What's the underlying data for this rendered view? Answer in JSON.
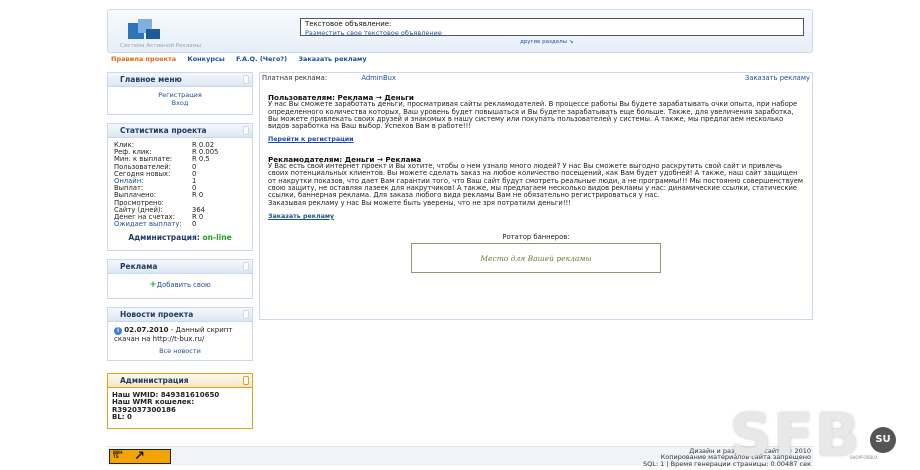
{
  "header": {
    "logo_text": "Система Активной Рекламы",
    "ad_title": "Текстовое объявление:",
    "ad_link": "Разместить свое текстовое объявление",
    "other_sections": "другие разделы ↘"
  },
  "nav": {
    "items": [
      "Правила проекта",
      "Конкурсы",
      "F.A.Q. (Чего?)",
      "Заказать рекламу"
    ]
  },
  "menu": {
    "title": "Главное меню",
    "register": "Регистрация",
    "login": "Вход"
  },
  "stats": {
    "title": "Статистика проекта",
    "rows": [
      {
        "k": "Клик:",
        "v": "R 0.02"
      },
      {
        "k": "Реф. клик:",
        "v": "R 0.005"
      },
      {
        "k": "Мин. к выплате:",
        "v": "R 0.5"
      },
      {
        "k": "Пользователей:",
        "v": "0"
      },
      {
        "k": "Сегодня новых:",
        "v": "0"
      },
      {
        "k": "Онлайн:",
        "v": "1"
      },
      {
        "k": "Выплат:",
        "v": "0"
      },
      {
        "k": "Выплачено:",
        "v": "R 0"
      },
      {
        "k": "Просмотрено:",
        "v": ""
      },
      {
        "k": "Сайту (дней):",
        "v": "364"
      },
      {
        "k": "Денег на счетах:",
        "v": "R  0"
      },
      {
        "k": "Ожидает выплату:",
        "v": "0"
      }
    ],
    "admin_label": "Администрация:",
    "admin_status": "on-line"
  },
  "ads": {
    "title": "Реклама",
    "add_label": "Добавить свою"
  },
  "news": {
    "title": "Новости проекта",
    "date": "02.07.2010",
    "text": " - Данный скрипт скачан на http://t-bux.ru/",
    "all": "Все новости"
  },
  "admin": {
    "title": "Администрация",
    "wmid": "Наш WMID: 849381610650",
    "wmr_label": "Наш WMR кошелек:",
    "wmr": "R392037300186",
    "bl": "BL:    0"
  },
  "main": {
    "label": "Платная реклама:",
    "admin": "AdminBux",
    "order": "Заказать рекламу",
    "users_title": "Пользователям: Реклама → Деньги",
    "users_text": "У нас Вы сможете заработать деньги, просматривая сайты рекламодателей. В процессе работы Вы будете зарабатывать очки опыта, при наборе определенного количества которых, Ваш уровень будет повышаться и Вы будете зарабатывать еще больше. Также, для увеличения заработка, Вы можете привлекать своих друзей и знакомых в нашу систему или покупать пользователей у системы. А также, мы предлагаем несколько видов заработка на Ваш выбор. Успехов Вам в работе!!!",
    "register_link": "Перейти к регистрации",
    "adv_title": "Рекламодателям: Деньги → Реклама",
    "adv_text": "У Вас есть свой интернет проект и Вы хотите, чтобы о нем узнало много людей? У нас Вы сможете выгодно раскрутить свой сайт и привлечь своих потенциальных клиентов. Вы можете сделать заказ на любое количество посещений, как Вам будет удобней! А также, наш сайт защищен от накрутки показов, что дает Вам гарантии того, что Ваш сайт будут смотреть реальные люди, а не программы!!! Мы постоянно совершенствуем свою защиту, не оставляя лазеек для накрутчиков! А также, мы предлагаем несколько видов рекламы у нас: динамические ссылки, статические ссылки, баннерная реклама. Для заказа любого вида рекламы Вам не обязательно регистрироваться у нас.",
    "adv_text2": "Заказывая рекламу у нас Вы можете быть уверены, что не зря потратили деньги!!!",
    "order_link": "Заказать рекламу",
    "rotator_title": "Ротатор баннеров:",
    "rotator_placeholder": "Место для Вашей рекламы"
  },
  "footer": {
    "counter_text": "BBH\nTS",
    "line1": "Дизайн и разработка сайта",
    "line1b": "© 2010",
    "line2": "Копирование материалов сайта запрещено",
    "line3": "SQL: 1 | Время генерации страницы: 0.00487 сек"
  },
  "watermark": {
    "letters": "SFB",
    "su": "SU",
    "sub": "SHOPFORBUX"
  }
}
